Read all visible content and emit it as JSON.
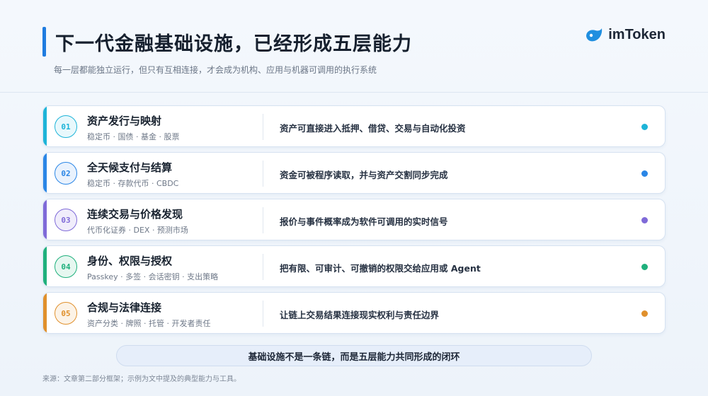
{
  "header": {
    "title": "下一代金融基础设施，已经形成五层能力",
    "subtitle": "每一层都能独立运行，但只有互相连接，才会成为机构、应用与机器可调用的执行系统"
  },
  "brand": {
    "name": "imToken",
    "icon": "imtoken-logo-icon",
    "color": "#1f8fe0"
  },
  "layers": [
    {
      "num": "01",
      "title": "资产发行与映射",
      "sub": "稳定币 · 国债 · 基金 · 股票",
      "desc": "资产可直接进入抵押、借贷、交易与自动化投资",
      "color": "#1db4d8",
      "tint": "#e8f8fc"
    },
    {
      "num": "02",
      "title": "全天候支付与结算",
      "sub": "稳定币 · 存款代币 · CBDC",
      "desc": "资金可被程序读取，并与资产交割同步完成",
      "color": "#2a86e6",
      "tint": "#e9f2fd"
    },
    {
      "num": "03",
      "title": "连续交易与价格发现",
      "sub": "代币化证券 · DEX · 预测市场",
      "desc": "报价与事件概率成为软件可调用的实时信号",
      "color": "#7f6ad8",
      "tint": "#f0edfb"
    },
    {
      "num": "04",
      "title": "身份、权限与授权",
      "sub": "Passkey · 多签 · 会话密钥 · 支出策略",
      "desc": "把有限、可审计、可撤销的权限交给应用或 Agent",
      "color": "#1fb07c",
      "tint": "#e6f7f0"
    },
    {
      "num": "05",
      "title": "合规与法律连接",
      "sub": "资产分类 · 牌照 · 托管 · 开发者责任",
      "desc": "让链上交易结果连接现实权利与责任边界",
      "color": "#e0902c",
      "tint": "#fcf3e7"
    }
  ],
  "summary": "基础设施不是一条链，而是五层能力共同形成的闭环",
  "source": "来源：文章第二部分框架；示例为文中提及的典型能力与工具。"
}
